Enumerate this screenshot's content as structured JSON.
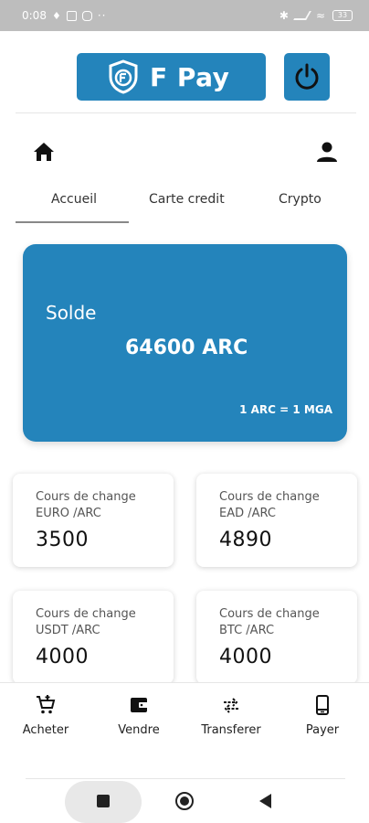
{
  "status_bar": {
    "time": "0:08",
    "battery": "33",
    "overflow": "··"
  },
  "header": {
    "brand": "F Pay",
    "accent_color": "#2484bb"
  },
  "tabs": [
    {
      "label": "Accueil",
      "active": true
    },
    {
      "label": "Carte credit",
      "active": false
    },
    {
      "label": "Crypto",
      "active": false
    }
  ],
  "balance": {
    "label": "Solde",
    "amount": "64600 ARC",
    "rate": "1 ARC = 1 MGA"
  },
  "rates": [
    {
      "label": "Cours de change",
      "pair": "EURO /ARC",
      "value": "3500"
    },
    {
      "label": "Cours de change",
      "pair": "EAD /ARC",
      "value": "4890"
    },
    {
      "label": "Cours de change",
      "pair": "USDT /ARC",
      "value": "4000"
    },
    {
      "label": "Cours de change",
      "pair": "BTC /ARC",
      "value": "4000"
    }
  ],
  "bottom_nav": [
    {
      "label": "Acheter",
      "icon": "cart-plus-icon"
    },
    {
      "label": "Vendre",
      "icon": "wallet-icon"
    },
    {
      "label": "Transferer",
      "icon": "swap-arrows-icon"
    },
    {
      "label": "Payer",
      "icon": "phone-icon"
    }
  ]
}
